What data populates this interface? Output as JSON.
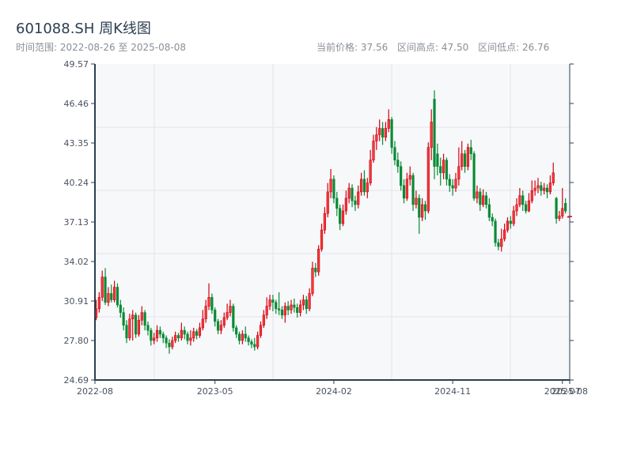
{
  "header": {
    "title": "601088.SH 周K线图",
    "range_text": "时间范围: 2022-08-26 至 2025-08-08",
    "current_price": "当前价格: 37.56",
    "range_high": "区间高点: 47.50",
    "range_low": "区间低点: 26.76"
  },
  "colors": {
    "up": "#d40010",
    "down": "#0a8a35",
    "plot_bg": "#f6f8fa",
    "axis": "#2c3e50",
    "grid": "#e2e5ea"
  },
  "chart_data": {
    "type": "candlestick",
    "title": "601088.SH 周K线图",
    "ylim": [
      24.69,
      49.57
    ],
    "y_ticks": [
      "24.69",
      "27.80",
      "30.91",
      "34.02",
      "37.13",
      "40.24",
      "43.35",
      "46.46",
      "49.57"
    ],
    "x_ticks": [
      {
        "label": "2022-08",
        "index": 0
      },
      {
        "label": "2023-05",
        "index": 39
      },
      {
        "label": "2024-02",
        "index": 78
      },
      {
        "label": "2024-11",
        "index": 117
      },
      {
        "label": "2025-07",
        "index": 153
      },
      {
        "label": "2025-08",
        "index": 155
      }
    ],
    "grid": true,
    "candle_fields": [
      "open",
      "high",
      "low",
      "close"
    ],
    "candles": [
      [
        29.6,
        31.0,
        29.4,
        30.3
      ],
      [
        30.3,
        31.6,
        30.0,
        31.2
      ],
      [
        31.2,
        33.3,
        30.9,
        32.8
      ],
      [
        32.8,
        33.5,
        30.6,
        30.8
      ],
      [
        30.8,
        32.0,
        30.5,
        31.5
      ],
      [
        31.5,
        32.2,
        30.8,
        31.0
      ],
      [
        31.0,
        32.5,
        30.8,
        32.0
      ],
      [
        32.0,
        32.3,
        30.4,
        30.6
      ],
      [
        30.6,
        31.0,
        29.6,
        30.0
      ],
      [
        30.0,
        30.4,
        28.6,
        29.0
      ],
      [
        29.0,
        29.4,
        27.6,
        28.0
      ],
      [
        28.0,
        29.9,
        27.8,
        29.5
      ],
      [
        29.5,
        30.2,
        27.8,
        29.8
      ],
      [
        29.8,
        30.0,
        28.0,
        28.3
      ],
      [
        28.3,
        29.8,
        28.1,
        29.4
      ],
      [
        29.4,
        30.5,
        29.0,
        30.0
      ],
      [
        30.0,
        30.2,
        28.6,
        29.0
      ],
      [
        29.0,
        29.3,
        28.2,
        28.6
      ],
      [
        28.6,
        28.8,
        27.4,
        27.8
      ],
      [
        27.8,
        28.4,
        27.5,
        28.0
      ],
      [
        28.0,
        29.0,
        27.7,
        28.6
      ],
      [
        28.6,
        28.9,
        28.0,
        28.3
      ],
      [
        28.3,
        28.5,
        27.6,
        28.0
      ],
      [
        28.0,
        28.2,
        27.2,
        27.6
      ],
      [
        27.6,
        27.9,
        26.76,
        27.3
      ],
      [
        27.3,
        28.1,
        27.1,
        27.8
      ],
      [
        27.8,
        28.5,
        27.6,
        28.2
      ],
      [
        28.2,
        28.4,
        27.7,
        28.0
      ],
      [
        28.0,
        29.2,
        27.8,
        28.6
      ],
      [
        28.6,
        28.9,
        27.9,
        28.3
      ],
      [
        28.3,
        28.5,
        27.5,
        27.8
      ],
      [
        27.8,
        28.6,
        27.4,
        28.0
      ],
      [
        28.0,
        28.8,
        27.7,
        28.5
      ],
      [
        28.5,
        28.7,
        27.9,
        28.2
      ],
      [
        28.2,
        29.2,
        28.0,
        28.8
      ],
      [
        28.8,
        30.2,
        28.6,
        29.5
      ],
      [
        29.5,
        31.0,
        29.2,
        30.5
      ],
      [
        30.5,
        32.3,
        30.2,
        31.2
      ],
      [
        31.2,
        31.5,
        29.9,
        30.2
      ],
      [
        30.2,
        30.4,
        28.9,
        29.3
      ],
      [
        29.3,
        29.5,
        28.3,
        28.6
      ],
      [
        28.6,
        29.4,
        28.3,
        29.0
      ],
      [
        29.0,
        30.0,
        28.8,
        29.6
      ],
      [
        29.6,
        30.7,
        29.4,
        30.0
      ],
      [
        30.0,
        31.0,
        29.7,
        30.5
      ],
      [
        30.5,
        30.7,
        28.5,
        28.8
      ],
      [
        28.8,
        29.0,
        28.0,
        28.3
      ],
      [
        28.3,
        28.5,
        27.5,
        27.8
      ],
      [
        27.8,
        28.6,
        27.5,
        28.3
      ],
      [
        28.3,
        28.9,
        27.7,
        28.0
      ],
      [
        28.0,
        28.2,
        27.4,
        27.7
      ],
      [
        27.7,
        27.9,
        27.2,
        27.5
      ],
      [
        27.5,
        28.0,
        27.0,
        27.3
      ],
      [
        27.3,
        28.5,
        27.1,
        28.2
      ],
      [
        28.2,
        29.3,
        28.0,
        29.0
      ],
      [
        29.0,
        30.2,
        28.8,
        29.8
      ],
      [
        29.8,
        31.2,
        29.5,
        30.5
      ],
      [
        30.5,
        31.4,
        30.2,
        31.0
      ],
      [
        31.0,
        31.4,
        30.1,
        30.8
      ],
      [
        30.8,
        31.0,
        29.9,
        30.3
      ],
      [
        30.3,
        31.6,
        29.8,
        30.2
      ],
      [
        30.2,
        30.5,
        29.5,
        29.8
      ],
      [
        29.8,
        30.8,
        29.2,
        30.5
      ],
      [
        30.5,
        30.9,
        29.8,
        30.2
      ],
      [
        30.2,
        31.0,
        29.9,
        30.6
      ],
      [
        30.6,
        31.1,
        30.0,
        30.4
      ],
      [
        30.4,
        30.7,
        29.6,
        30.0
      ],
      [
        30.0,
        31.0,
        29.7,
        30.6
      ],
      [
        30.6,
        31.4,
        30.2,
        31.0
      ],
      [
        31.0,
        31.3,
        29.9,
        30.3
      ],
      [
        30.3,
        31.9,
        30.1,
        31.5
      ],
      [
        31.5,
        34.0,
        31.3,
        33.5
      ],
      [
        33.5,
        33.9,
        32.8,
        33.2
      ],
      [
        33.2,
        35.3,
        32.9,
        35.0
      ],
      [
        35.0,
        37.0,
        34.8,
        36.5
      ],
      [
        36.5,
        38.3,
        36.2,
        37.8
      ],
      [
        37.8,
        40.2,
        37.5,
        39.5
      ],
      [
        39.5,
        41.3,
        39.0,
        40.5
      ],
      [
        40.5,
        40.8,
        38.6,
        39.0
      ],
      [
        39.0,
        39.5,
        37.6,
        38.2
      ],
      [
        38.2,
        38.5,
        36.5,
        37.0
      ],
      [
        37.0,
        38.5,
        36.8,
        38.0
      ],
      [
        38.0,
        39.6,
        37.7,
        39.0
      ],
      [
        39.0,
        40.2,
        38.6,
        39.8
      ],
      [
        39.8,
        40.1,
        38.3,
        38.8
      ],
      [
        38.8,
        39.2,
        38.0,
        38.5
      ],
      [
        38.5,
        40.0,
        38.2,
        39.5
      ],
      [
        39.5,
        41.0,
        39.2,
        40.5
      ],
      [
        40.5,
        41.2,
        39.2,
        39.5
      ],
      [
        39.5,
        40.6,
        39.0,
        40.2
      ],
      [
        40.2,
        42.8,
        40.0,
        42.0
      ],
      [
        42.0,
        44.0,
        41.8,
        43.5
      ],
      [
        43.5,
        44.6,
        42.8,
        44.0
      ],
      [
        44.0,
        45.2,
        43.5,
        44.5
      ],
      [
        44.5,
        45.0,
        43.2,
        43.8
      ],
      [
        43.8,
        45.0,
        43.5,
        44.5
      ],
      [
        44.5,
        46.0,
        44.2,
        45.2
      ],
      [
        45.2,
        45.4,
        42.5,
        43.0
      ],
      [
        43.0,
        43.5,
        41.6,
        42.0
      ],
      [
        42.0,
        42.6,
        41.0,
        41.5
      ],
      [
        41.5,
        41.9,
        39.6,
        40.0
      ],
      [
        40.0,
        40.5,
        38.6,
        39.0
      ],
      [
        39.0,
        41.0,
        38.8,
        40.5
      ],
      [
        40.5,
        41.5,
        40.0,
        40.8
      ],
      [
        40.8,
        41.0,
        38.0,
        38.5
      ],
      [
        38.5,
        39.6,
        38.2,
        39.0
      ],
      [
        39.0,
        39.3,
        36.2,
        37.5
      ],
      [
        37.5,
        39.0,
        37.2,
        38.5
      ],
      [
        38.5,
        38.8,
        37.3,
        38.0
      ],
      [
        38.0,
        43.4,
        37.8,
        43.0
      ],
      [
        43.0,
        46.0,
        42.0,
        45.0
      ],
      [
        46.8,
        47.5,
        40.5,
        41.5
      ],
      [
        42.5,
        43.3,
        40.8,
        41.5
      ],
      [
        41.5,
        42.2,
        40.0,
        41.0
      ],
      [
        41.0,
        42.5,
        40.5,
        42.0
      ],
      [
        42.0,
        42.2,
        40.0,
        40.5
      ],
      [
        40.5,
        40.9,
        39.5,
        40.0
      ],
      [
        40.0,
        40.5,
        39.2,
        39.8
      ],
      [
        39.8,
        41.0,
        39.5,
        40.5
      ],
      [
        40.5,
        43.0,
        40.0,
        41.5
      ],
      [
        41.5,
        43.5,
        41.2,
        42.5
      ],
      [
        42.5,
        42.8,
        41.0,
        41.5
      ],
      [
        41.5,
        43.3,
        41.2,
        43.0
      ],
      [
        43.0,
        43.6,
        42.0,
        42.5
      ],
      [
        42.5,
        42.7,
        38.8,
        39.0
      ],
      [
        39.0,
        40.0,
        38.6,
        39.5
      ],
      [
        39.5,
        39.8,
        38.0,
        38.5
      ],
      [
        38.5,
        39.7,
        38.3,
        39.2
      ],
      [
        39.2,
        39.5,
        38.2,
        38.5
      ],
      [
        38.5,
        39.0,
        37.2,
        37.5
      ],
      [
        37.5,
        37.8,
        36.8,
        37.2
      ],
      [
        37.2,
        37.4,
        35.2,
        35.5
      ],
      [
        35.5,
        35.8,
        34.9,
        35.2
      ],
      [
        35.2,
        36.6,
        34.8,
        35.8
      ],
      [
        35.8,
        37.0,
        35.6,
        36.5
      ],
      [
        36.5,
        37.5,
        36.3,
        37.2
      ],
      [
        37.2,
        37.6,
        36.6,
        37.0
      ],
      [
        37.0,
        38.4,
        36.8,
        38.0
      ],
      [
        38.0,
        39.0,
        37.6,
        38.5
      ],
      [
        38.5,
        39.8,
        38.3,
        39.2
      ],
      [
        39.2,
        39.6,
        38.0,
        38.5
      ],
      [
        38.5,
        38.8,
        37.8,
        38.0
      ],
      [
        38.0,
        39.4,
        37.9,
        38.8
      ],
      [
        38.8,
        40.4,
        38.6,
        39.6
      ],
      [
        39.6,
        40.4,
        39.2,
        39.8
      ],
      [
        39.8,
        40.6,
        39.4,
        40.0
      ],
      [
        40.0,
        40.3,
        39.2,
        39.6
      ],
      [
        39.6,
        40.2,
        39.3,
        39.8
      ],
      [
        39.8,
        40.1,
        39.0,
        39.5
      ],
      [
        39.5,
        40.8,
        39.3,
        40.2
      ],
      [
        40.2,
        41.8,
        40.0,
        41.0
      ],
      [
        39.0,
        39.1,
        37.0,
        37.4
      ],
      [
        37.4,
        38.0,
        37.2,
        37.6
      ],
      [
        37.6,
        39.8,
        37.4,
        38.2
      ],
      [
        38.6,
        39.0,
        37.8,
        38.0
      ],
      [
        37.56,
        37.6,
        37.5,
        37.56
      ]
    ]
  }
}
